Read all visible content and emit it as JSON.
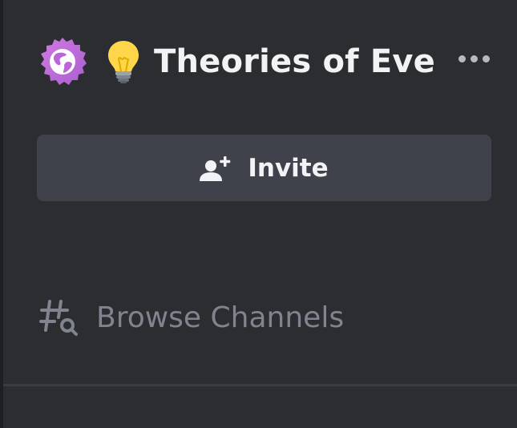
{
  "server": {
    "name": "Theories of Eve...",
    "badge_icon": "globe-icon",
    "badge_color": "#c06fd6",
    "emoji_icon": "lightbulb-icon"
  },
  "header": {
    "more_icon": "more-options-icon"
  },
  "invite": {
    "label": "Invite",
    "icon": "add-person-icon"
  },
  "browse": {
    "label": "Browse Channels",
    "icon": "channel-search-icon"
  },
  "colors": {
    "background": "#2b2d31",
    "button_bg": "#3f424b",
    "text_primary": "#f2f3f5",
    "text_muted": "#80848e"
  }
}
